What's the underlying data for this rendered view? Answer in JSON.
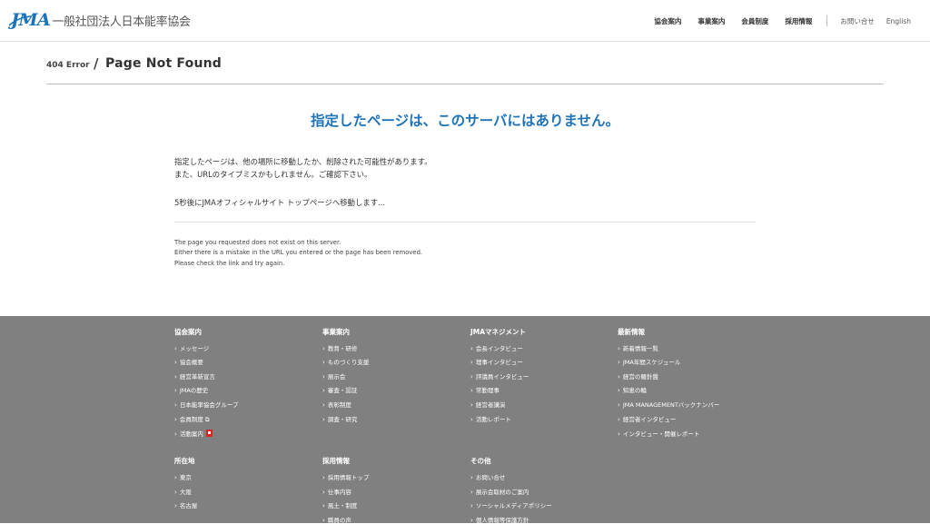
{
  "header": {
    "logo_mark": "JMA",
    "logo_text": "一般社団法人日本能率協会",
    "nav": [
      "協会案内",
      "事業案内",
      "会員制度",
      "採用情報"
    ],
    "sub_nav": [
      "お問い合せ",
      "English"
    ]
  },
  "page_head": {
    "code": "404 Error",
    "slash": "/",
    "title": "Page Not Found"
  },
  "main": {
    "heading": "指定したページは、このサーバにはありません。",
    "line1": "指定したページは、他の場所に移動したか、削除された可能性があります。",
    "line2": "また、URLのタイプミスかもしれません。ご確認下さい。",
    "redirect": "5秒後にJMAオフィシャルサイト トップページへ移動します...",
    "en1": "The page you requested does not exist on this server.",
    "en2": "Either there is a mistake in the URL you entered or the page has been removed.",
    "en3": "Please check the link and try again."
  },
  "footer": {
    "col1": {
      "title": "協会案内",
      "items": [
        "メッセージ",
        "協会概要",
        "経営革新宣言",
        "JMAの歴史",
        "日本能率協会グループ",
        "会員制度",
        "活動案内"
      ]
    },
    "col2": {
      "title": "事業案内",
      "items": [
        "教育・研修",
        "ものづくり支援",
        "展示会",
        "審査・認証",
        "表彰制度",
        "調査・研究"
      ]
    },
    "col3": {
      "title": "JMAマネジメント",
      "items": [
        "会長インタビュー",
        "理事インタビュー",
        "評議員インタビュー",
        "常勤理事",
        "経営者講演",
        "活動レポート"
      ]
    },
    "col4": {
      "title": "最新情報",
      "items": [
        "新着情報一覧",
        "JMA年間スケジュール",
        "経営の羅針盤",
        "知恵の輪",
        "JMA MANAGEMENTバックナンバー",
        "経営者インタビュー",
        "インタビュー・開催レポート"
      ]
    },
    "col5": {
      "title": "所在地",
      "items": [
        "東京",
        "大阪",
        "名古屋"
      ]
    },
    "col6": {
      "title": "採用情報",
      "items": [
        "採用情報トップ",
        "仕事内容",
        "風土・制度",
        "職員の声"
      ]
    },
    "col7": {
      "title": "その他",
      "items": [
        "お問い合せ",
        "展示会取材のご案内",
        "ソーシャルメディアポリシー",
        "個人情報等保護方針"
      ]
    },
    "chevron": "›",
    "ext_symbol": "⧉"
  }
}
